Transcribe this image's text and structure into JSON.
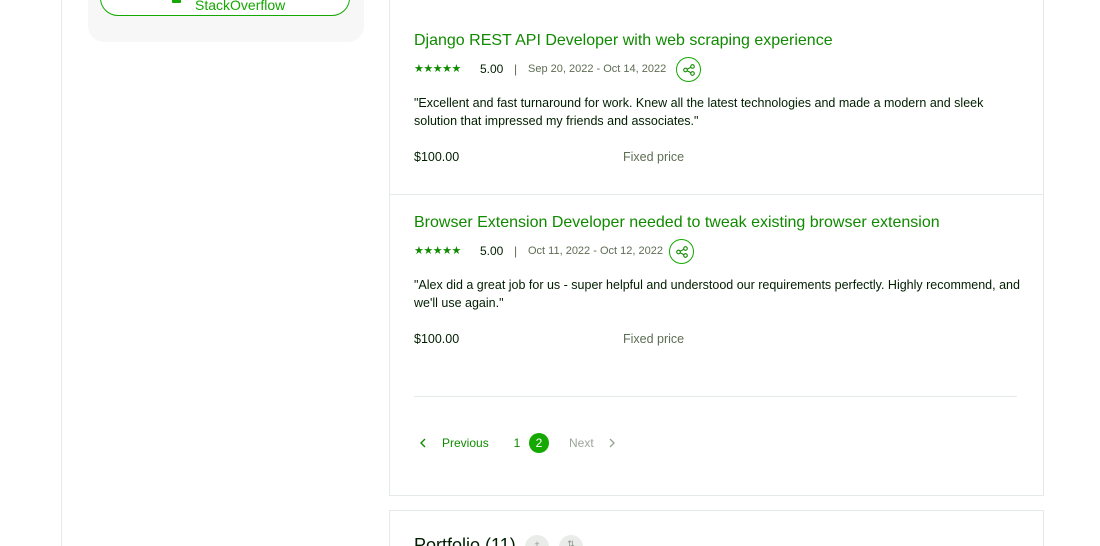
{
  "sidebar": {
    "button_label": "StackOverflow"
  },
  "jobs": [
    {
      "title": "Django REST API Developer with web scraping experience",
      "stars": "★★★★★",
      "rating": "5.00",
      "separator": "|",
      "dates": "Sep 20, 2022 - Oct 14, 2022",
      "quote": "\"Excellent and fast turnaround for work. Knew all the latest technologies and made a modern and sleek solution that impressed my friends and associates.\"",
      "amount": "$100.00",
      "price_type": "Fixed price"
    },
    {
      "title": "Browser Extension Developer needed to tweak existing browser extension",
      "stars": "★★★★★",
      "rating": "5.00",
      "separator": "|",
      "dates": "Oct 11, 2022 - Oct 12, 2022",
      "quote": "\"Alex did a great job for us - super helpful and understood our requirements perfectly. Highly recommend, and we'll use again.\"",
      "amount": "$100.00",
      "price_type": "Fixed price"
    }
  ],
  "pagination": {
    "previous_label": "Previous",
    "pages": [
      "1",
      "2"
    ],
    "current_page": "2",
    "next_label": "Next"
  },
  "portfolio": {
    "title": "Portfolio (11)"
  },
  "colors": {
    "brand_green": "#14a800",
    "link_green": "#108a00",
    "text_dark": "#001e00",
    "text_muted": "#5e6d55",
    "border": "#e4ebe4"
  },
  "icons": {
    "share": "share-icon",
    "prev": "chevron-left-icon",
    "next": "chevron-right-icon"
  }
}
